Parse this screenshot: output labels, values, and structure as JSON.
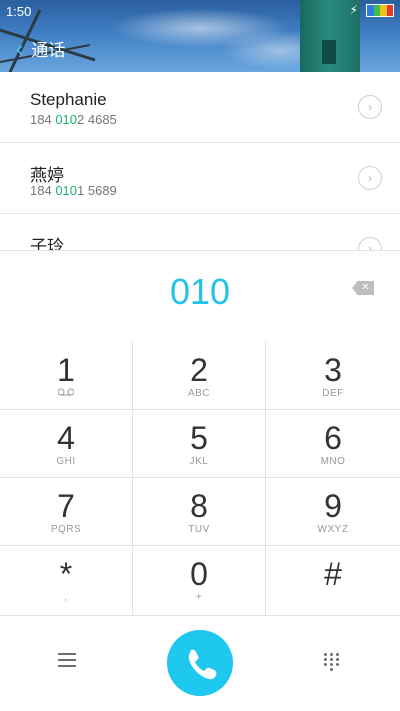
{
  "status_bar": {
    "time": "1:50"
  },
  "header": {
    "back_label": "通话",
    "back_icon": "chevron-left-icon"
  },
  "contacts": [
    {
      "name": "Stephanie",
      "number_pre": "184 ",
      "number_hl": "010",
      "number_post": "2 4685"
    },
    {
      "name": "燕婷",
      "number_pre": "184 ",
      "number_hl": "010",
      "number_post": "1 5689"
    },
    {
      "name": "子玲",
      "number_pre": "",
      "number_hl": "",
      "number_post": ""
    }
  ],
  "display": {
    "digits": "010"
  },
  "keypad": [
    {
      "digit": "1",
      "letters": ""
    },
    {
      "digit": "2",
      "letters": "ABC"
    },
    {
      "digit": "3",
      "letters": "DEF"
    },
    {
      "digit": "4",
      "letters": "GHI"
    },
    {
      "digit": "5",
      "letters": "JKL"
    },
    {
      "digit": "6",
      "letters": "MNO"
    },
    {
      "digit": "7",
      "letters": "PQRS"
    },
    {
      "digit": "8",
      "letters": "TUV"
    },
    {
      "digit": "9",
      "letters": "WXYZ"
    },
    {
      "digit": "*",
      "letters": ","
    },
    {
      "digit": "0",
      "letters": "+"
    },
    {
      "digit": "#",
      "letters": ""
    }
  ],
  "colors": {
    "accent": "#1fc8ef",
    "match_highlight": "#1bb36b"
  }
}
